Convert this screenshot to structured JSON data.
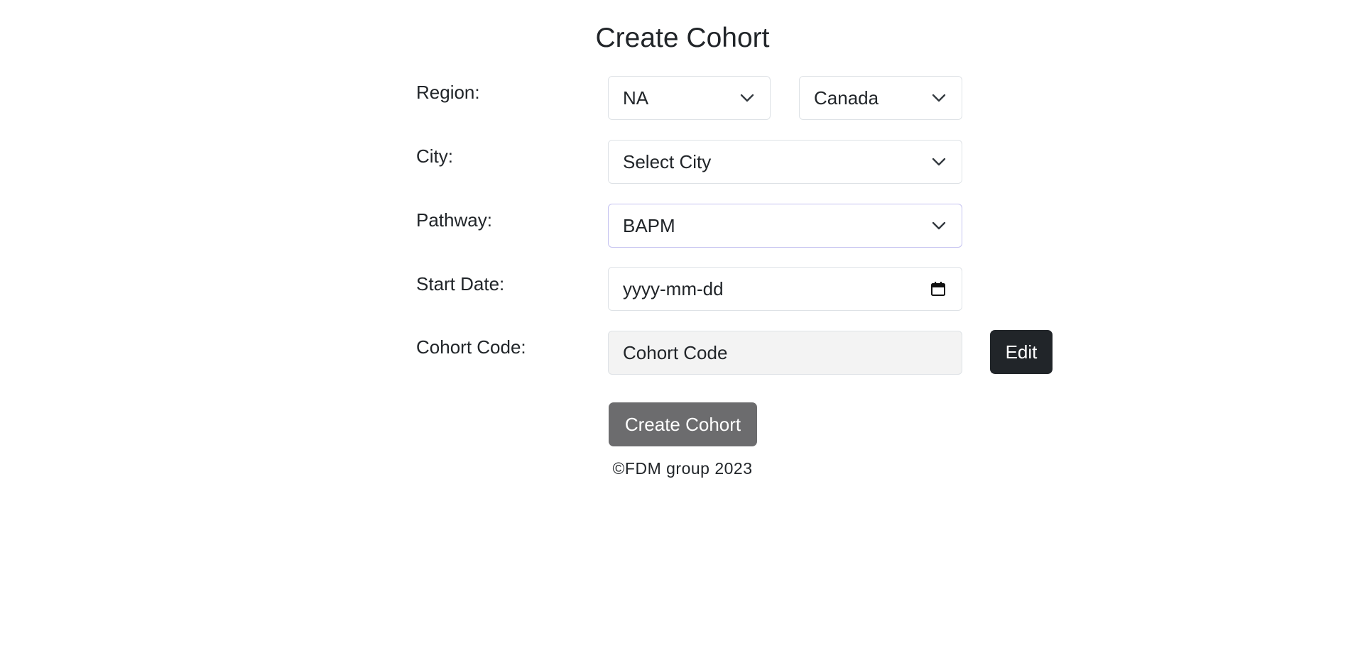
{
  "page": {
    "title": "Create Cohort"
  },
  "form": {
    "region": {
      "label": "Region:",
      "region_value": "NA",
      "country_value": "Canada"
    },
    "city": {
      "label": "City:",
      "value": "Select City"
    },
    "pathway": {
      "label": "Pathway:",
      "value": "BAPM"
    },
    "start_date": {
      "label": "Start Date:",
      "placeholder": "yyyy-mm-dd"
    },
    "cohort_code": {
      "label": "Cohort Code:",
      "placeholder": "Cohort Code",
      "edit_label": "Edit"
    },
    "submit_label": "Create Cohort"
  },
  "footer": {
    "text": "©FDM group 2023"
  },
  "icons": {
    "dropdown": "chevron-down-icon",
    "date": "calendar-icon"
  },
  "colors": {
    "edit_button": "#212529",
    "create_button": "#6c6c6e",
    "readonly_field": "#f3f3f3"
  }
}
